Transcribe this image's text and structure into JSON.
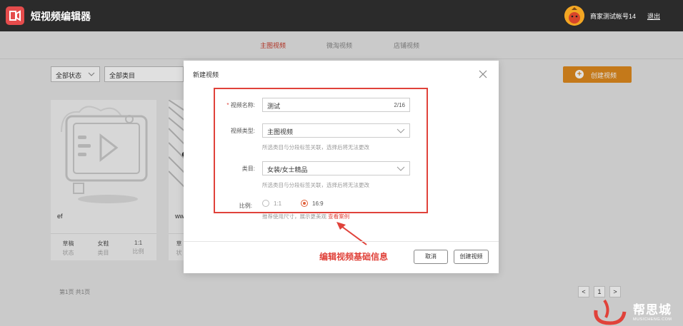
{
  "header": {
    "app_title": "短视频编辑器",
    "username": "商家测试帐号14",
    "logout": "退出"
  },
  "tabs": [
    {
      "label": "主图视频",
      "active": true
    },
    {
      "label": "微淘视频",
      "active": false
    },
    {
      "label": "店铺视频",
      "active": false
    }
  ],
  "filters": {
    "status": "全部状态",
    "category": "全部类目"
  },
  "create_button": "创建视频",
  "cards": [
    {
      "name": "ef",
      "meta": [
        {
          "value": "草稿",
          "label": "状态"
        },
        {
          "value": "女鞋",
          "label": "类目"
        },
        {
          "value": "1:1",
          "label": "比例"
        }
      ]
    },
    {
      "name": "ww",
      "meta": [
        {
          "value": "草",
          "label": "状"
        }
      ]
    }
  ],
  "pagination": {
    "text": "第1页 共1页",
    "prev": "<",
    "current": "1",
    "next": ">"
  },
  "dialog": {
    "title": "新建视频",
    "name_label": "视频名称:",
    "name_value": "测试",
    "name_count": "2/16",
    "type_label": "视频类型:",
    "type_value": "主图视频",
    "type_hint": "所选类目与分段标签关联，选择后将无法更改",
    "category_label": "类目:",
    "category_value": "女装/女士精品",
    "category_hint": "所选类目与分段标签关联，选择后将无法更改",
    "ratio_label": "比例:",
    "ratio_options": [
      {
        "label": "1:1",
        "selected": false
      },
      {
        "label": "16:9",
        "selected": true
      }
    ],
    "recommend_text": "推荐使用尺寸，展示更美观",
    "recommend_link": "查看案例",
    "cancel": "取消",
    "confirm": "创建视频"
  },
  "annotation": "编辑视频基础信息",
  "watermark": {
    "text": "帮思城",
    "sub": "MUSICHENG.COM"
  },
  "colors": {
    "accent": "#e08a1e",
    "active_tab": "#c83a2a",
    "annotation": "#e0423a"
  }
}
